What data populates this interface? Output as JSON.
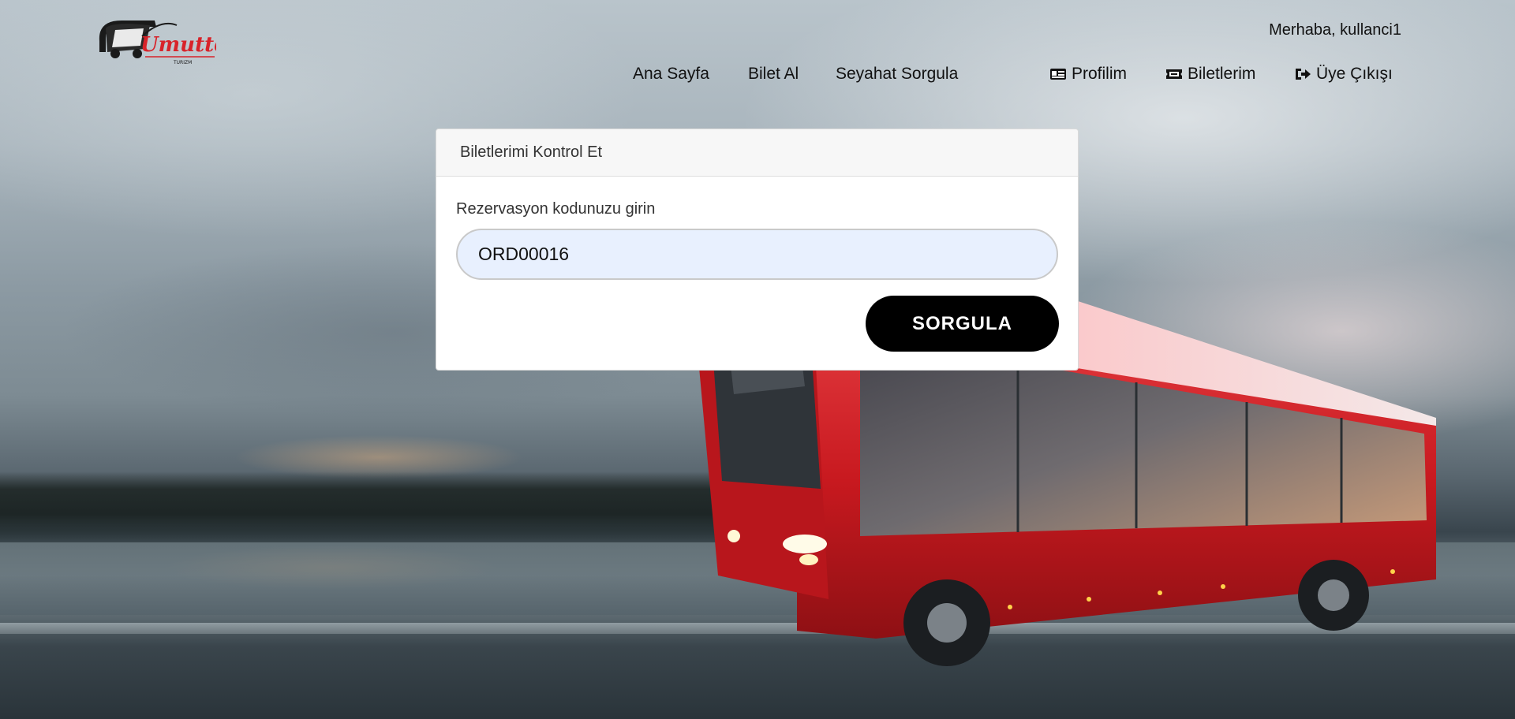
{
  "header": {
    "logo_text": "Umuttepe",
    "logo_subtext": "TURIZM",
    "greeting": "Merhaba, kullanci1"
  },
  "nav": {
    "items": [
      {
        "label": "Ana Sayfa"
      },
      {
        "label": "Bilet Al"
      },
      {
        "label": "Seyahat Sorgula"
      },
      {
        "label": "Profilim",
        "icon": "id-card-icon"
      },
      {
        "label": "Biletlerim",
        "icon": "ticket-icon"
      },
      {
        "label": "Üye Çıkışı",
        "icon": "sign-out-icon"
      }
    ]
  },
  "card": {
    "title": "Biletlerimi Kontrol Et",
    "label": "Rezervasyon kodunuzu girin",
    "input_value": "ORD00016",
    "button_label": "SORGULA"
  },
  "colors": {
    "button_bg": "#000000",
    "input_bg": "#e8f0fe",
    "logo_red": "#d8232a"
  }
}
